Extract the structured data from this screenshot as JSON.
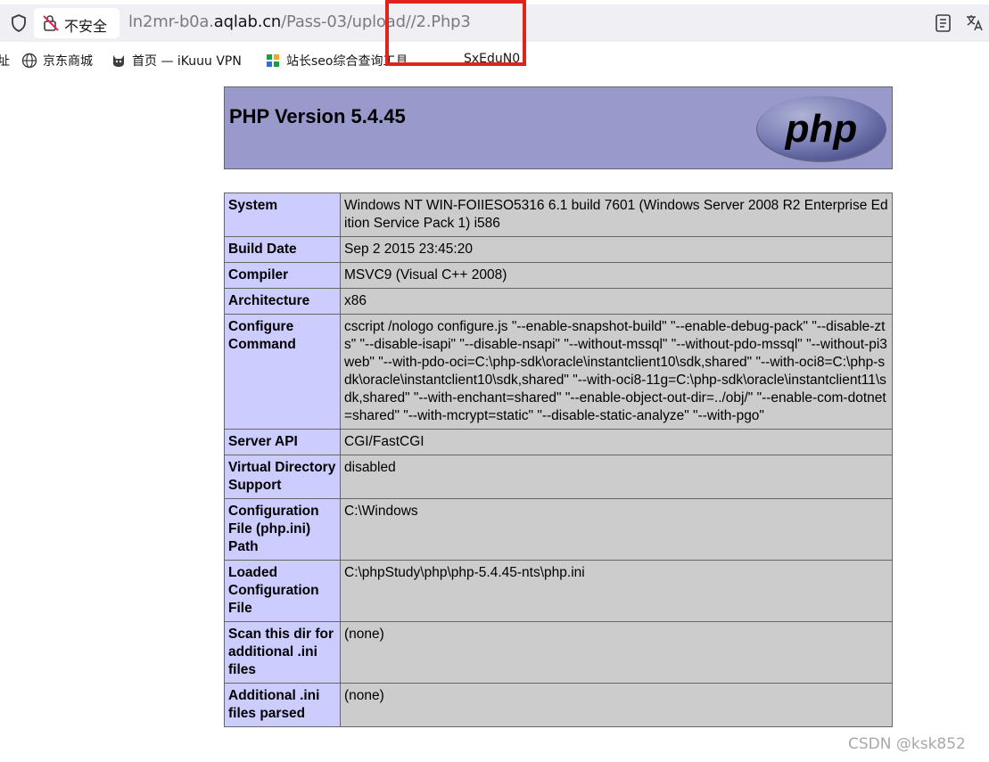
{
  "browser": {
    "security_label": "不安全",
    "url_prefix": "ln2mr-b0a.",
    "url_domain": "aqlab.cn",
    "url_path": "/Pass-03/upload//2.Php3",
    "highlight_color": "#e0231b"
  },
  "bookmarks": [
    {
      "label": "址",
      "icon": "none"
    },
    {
      "label": "京东商城",
      "icon": "globe-icon"
    },
    {
      "label": "首页 — iKuuu VPN",
      "icon": "cat-icon"
    },
    {
      "label": "站长seo综合查询工具",
      "icon": "seo-tool-icon"
    },
    {
      "label": "SxEduN0",
      "icon": "none"
    }
  ],
  "phpinfo": {
    "title": "PHP Version 5.4.45",
    "logo_text": "php",
    "header_color": "#9999cc",
    "rows": [
      {
        "key": "System",
        "value": "Windows NT WIN-FOIIESO5316 6.1 build 7601 (Windows Server 2008 R2 Enterprise Edition Service Pack 1) i586"
      },
      {
        "key": "Build Date",
        "value": "Sep 2 2015 23:45:20"
      },
      {
        "key": "Compiler",
        "value": "MSVC9 (Visual C++ 2008)"
      },
      {
        "key": "Architecture",
        "value": "x86"
      },
      {
        "key": "Configure Command",
        "value": "cscript /nologo configure.js \"--enable-snapshot-build\" \"--enable-debug-pack\" \"--disable-zts\" \"--disable-isapi\" \"--disable-nsapi\" \"--without-mssql\" \"--without-pdo-mssql\" \"--without-pi3web\" \"--with-pdo-oci=C:\\php-sdk\\oracle\\instantclient10\\sdk,shared\" \"--with-oci8=C:\\php-sdk\\oracle\\instantclient10\\sdk,shared\" \"--with-oci8-11g=C:\\php-sdk\\oracle\\instantclient11\\sdk,shared\" \"--with-enchant=shared\" \"--enable-object-out-dir=../obj/\" \"--enable-com-dotnet=shared\" \"--with-mcrypt=static\" \"--disable-static-analyze\" \"--with-pgo\""
      },
      {
        "key": "Server API",
        "value": "CGI/FastCGI"
      },
      {
        "key": "Virtual Directory Support",
        "value": "disabled"
      },
      {
        "key": "Configuration File (php.ini) Path",
        "value": "C:\\Windows"
      },
      {
        "key": "Loaded Configuration File",
        "value": "C:\\phpStudy\\php\\php-5.4.45-nts\\php.ini"
      },
      {
        "key": "Scan this dir for additional .ini files",
        "value": "(none)"
      },
      {
        "key": "Additional .ini files parsed",
        "value": "(none)"
      }
    ]
  },
  "watermark": "CSDN @ksk852"
}
